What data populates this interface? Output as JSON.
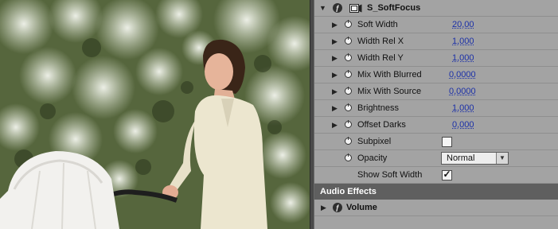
{
  "effect": {
    "name": "S_SoftFocus",
    "params": [
      {
        "label": "Soft Width",
        "value": "20,00"
      },
      {
        "label": "Width Rel X",
        "value": "1,000"
      },
      {
        "label": "Width Rel Y",
        "value": "1,000"
      },
      {
        "label": "Mix With Blurred",
        "value": "0,0000"
      },
      {
        "label": "Mix With Source",
        "value": "0,0000"
      },
      {
        "label": "Brightness",
        "value": "1,000"
      },
      {
        "label": "Offset Darks",
        "value": "0,000"
      }
    ],
    "subpixel": {
      "label": "Subpixel",
      "checked": false
    },
    "opacity": {
      "label": "Opacity",
      "value": "Normal"
    },
    "show_soft_width": {
      "label": "Show Soft Width",
      "checked": true
    }
  },
  "audio_section": {
    "title": "Audio Effects"
  },
  "audio_effect": {
    "name": "Volume"
  },
  "icons": {
    "twirl_open": "triangle-down-icon",
    "twirl_closed": "triangle-right-icon",
    "fx": "fx-icon",
    "clip": "clip-icon",
    "stopwatch": "stopwatch-icon",
    "dropdown": "chevron-down-icon",
    "check": "checkmark-icon"
  },
  "colors": {
    "value_link": "#1a2fa8",
    "panel_bg": "#a3a3a3",
    "section_bg": "#5f5f5f"
  }
}
